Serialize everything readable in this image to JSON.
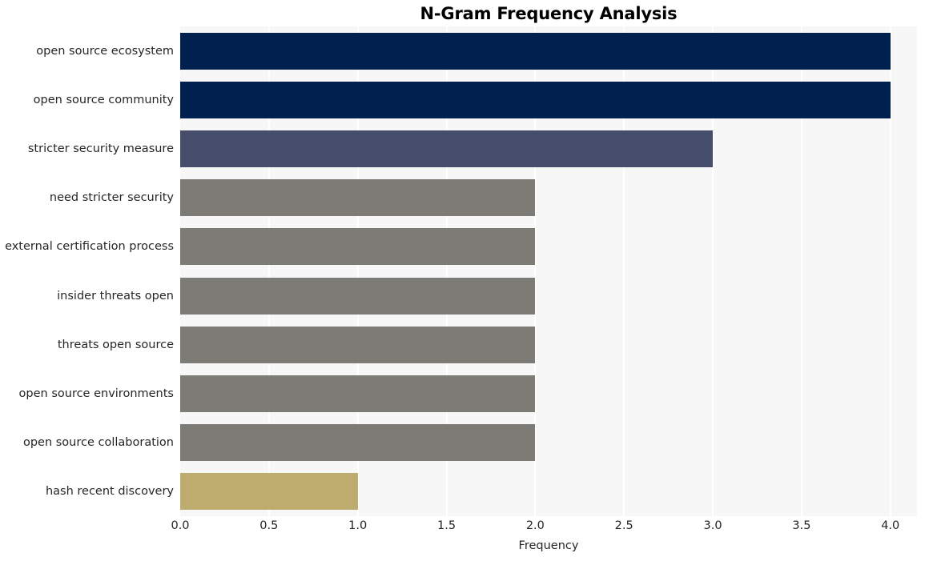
{
  "chart_data": {
    "type": "bar",
    "orientation": "horizontal",
    "title": "N-Gram Frequency Analysis",
    "xlabel": "Frequency",
    "ylabel": "",
    "xlim": [
      0.0,
      4.15
    ],
    "xticks": [
      "0.0",
      "0.5",
      "1.0",
      "1.5",
      "2.0",
      "2.5",
      "3.0",
      "3.5",
      "4.0"
    ],
    "xtick_values": [
      0.0,
      0.5,
      1.0,
      1.5,
      2.0,
      2.5,
      3.0,
      3.5,
      4.0
    ],
    "grid": true,
    "grid_axis": "x",
    "legend": "none",
    "categories": [
      "open source ecosystem",
      "open source community",
      "stricter security measure",
      "need stricter security",
      "external certification process",
      "insider threats open",
      "threats open source",
      "open source environments",
      "open source collaboration",
      "hash recent discovery"
    ],
    "values": [
      4,
      4,
      3,
      2,
      2,
      2,
      2,
      2,
      2,
      1
    ],
    "bar_colors": [
      "#002050",
      "#002050",
      "#454D6B",
      "#7D7B76",
      "#7D7B76",
      "#7D7B76",
      "#7D7B76",
      "#7D7B76",
      "#7D7B76",
      "#BDAC6E"
    ]
  },
  "style": {
    "plot_background": "#f7f7f7",
    "figure_background": "#ffffff",
    "gridline_color": "#ffffff",
    "text_color": "#262626",
    "title_color": "#000000"
  }
}
